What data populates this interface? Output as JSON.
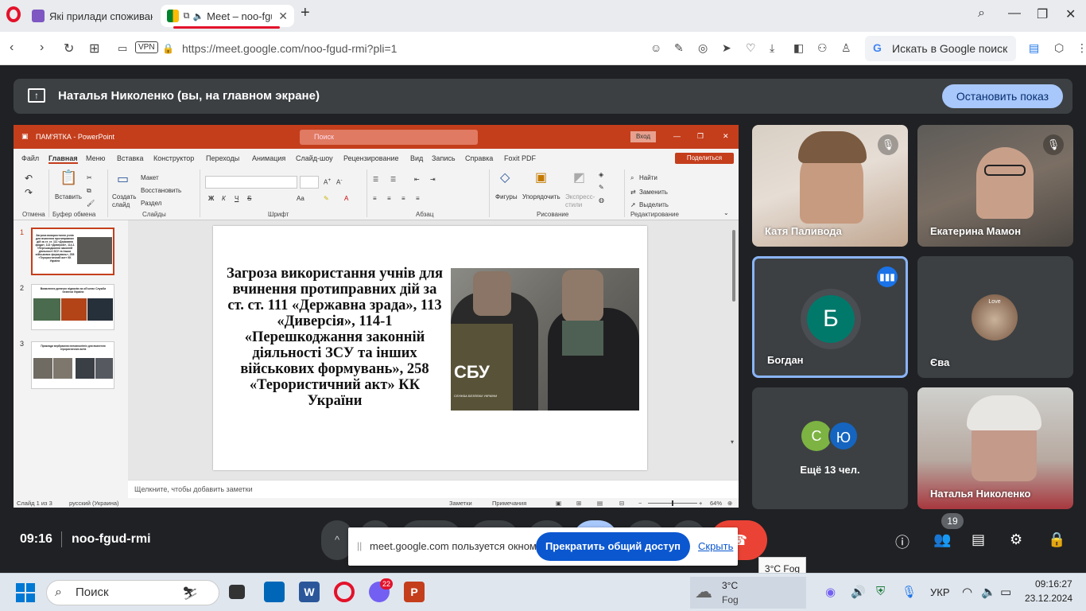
{
  "browser": {
    "tabs": [
      {
        "title": "Які прилади споживають"
      },
      {
        "title": "Meet – noo-fgud-r"
      }
    ],
    "url": "https://meet.google.com/noo-fgud-rmi?pli=1",
    "vpn_label": "VPN",
    "search_placeholder": "Искать в Google поиск"
  },
  "meet": {
    "presenting_text": "Наталья Николенко (вы, на главном экране)",
    "stop_button": "Остановить показ",
    "time": "09:16",
    "code": "noo-fgud-rmi",
    "participants_count": "19",
    "tiles": [
      {
        "name": "Катя Паливода"
      },
      {
        "name": "Екатерина Мамон"
      },
      {
        "name": "Богдан",
        "initial": "Б"
      },
      {
        "name": "Єва",
        "avatar_text": "Love"
      },
      {
        "name": "Ещё 13 чел.",
        "initials": [
          "С",
          "Ю"
        ]
      },
      {
        "name": "Наталья Николенко"
      }
    ],
    "popup": {
      "text": "meet.google.com пользуется окном.",
      "button": "Прекратить общий доступ",
      "hide": "Скрыть"
    }
  },
  "ppt": {
    "title": "ПАМ'ЯТКА - PowerPoint",
    "search": "Поиск",
    "login": "Вход",
    "tabs": [
      "Файл",
      "Главная",
      "Меню",
      "Вставка",
      "Конструктор",
      "Переходы",
      "Анимация",
      "Слайд-шоу",
      "Рецензирование",
      "Вид",
      "Запись",
      "Справка",
      "Foxit PDF"
    ],
    "share": "Поделиться",
    "ribbon": {
      "undo": "Отмена",
      "clipboard": "Буфер обмена",
      "paste": "Вставить",
      "create_slide": "Создать слайд",
      "layout": "Макет",
      "reset": "Восстановить",
      "section": "Раздел",
      "slides": "Слайды",
      "font": "Шрифт",
      "paragraph": "Абзац",
      "shapes": "Фигуры",
      "arrange": "Упорядочить",
      "quick_styles": "Экспресс-стили",
      "drawing": "Рисование",
      "find": "Найти",
      "replace": "Заменить",
      "select": "Выделить",
      "editing": "Редактирование"
    },
    "slide_numbers": [
      "1",
      "2",
      "3"
    ],
    "thumb_texts": [
      "Загроза використання учнів для вчинення протиправних дій за ст. ст. 111 «Державна зрада», 113 «Диверсія», 114-1 «Перешкоджання законній діяльності ЗСУ та інших військових формувань», 258 «Терористичний акт» КК України",
      "Виявлення дитячих підпалів на об'єктах Служби безпеки України",
      "Приклади вербування неповнолітніх для вчинення терористичних актів"
    ],
    "slide_text": "Загроза використання учнів для вчинення протиправних дій за ст. ст. 111 «Державна зрада», 113 «Диверсія», 114-1 «Перешкоджання законній діяльності ЗСУ та інших військових формувань», 258 «Терористичний акт» КК України",
    "photo_text": "СБУ",
    "photo_caption": "СЛУЖБА БЕЗПЕКИ УКРАЇНИ",
    "notes": "Щелкните, чтобы добавить заметки",
    "status": {
      "slide": "Слайд 1 из 3",
      "lang": "русский (Украина)",
      "notes": "Заметки",
      "comments": "Примечания",
      "zoom": "64%"
    }
  },
  "taskbar": {
    "search": "Поиск",
    "weather_temp": "3°C",
    "weather_desc": "Fog",
    "tooltip": "3°C Fog",
    "badge": "22",
    "lang": "УКР",
    "time": "09:16:27",
    "date": "23.12.2024"
  }
}
